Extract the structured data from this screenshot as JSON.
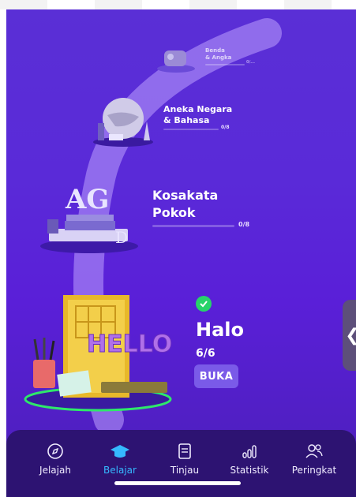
{
  "lessons": [
    {
      "title_line1": "Benda",
      "title_line2": "& Angka",
      "count": "0/..."
    },
    {
      "title_line1": "Aneka Negara",
      "title_line2": "& Bahasa",
      "count": "0/8"
    },
    {
      "title_line1": "Kosakata",
      "title_line2": "Pokok",
      "count": "0/8"
    }
  ],
  "current": {
    "title": "Halo",
    "progress": "6/6",
    "button": "BUKA"
  },
  "nav": [
    {
      "label": "Jelajah",
      "icon": "compass-icon"
    },
    {
      "label": "Belajar",
      "icon": "graduation-cap-icon"
    },
    {
      "label": "Tinjau",
      "icon": "book-icon"
    },
    {
      "label": "Statistik",
      "icon": "stats-icon"
    },
    {
      "label": "Peringkat",
      "icon": "people-icon"
    }
  ],
  "active_nav": "Belajar",
  "colors": {
    "accent": "#35b9ff",
    "background": "#5a2ad8",
    "nav_bg": "#2d1372",
    "check": "#27d36a"
  }
}
